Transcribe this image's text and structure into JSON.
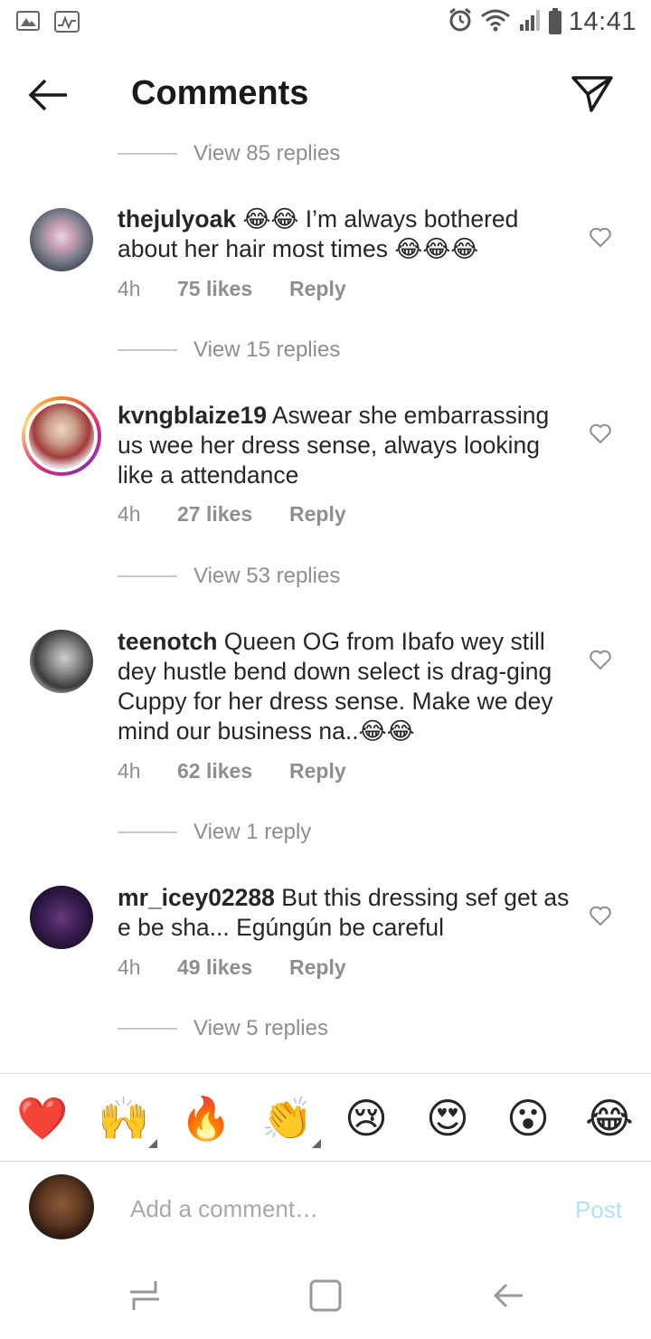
{
  "status_bar": {
    "time": "14:41",
    "left_icons": [
      "gallery-icon",
      "activity-icon"
    ],
    "right_icons": [
      "alarm-icon",
      "wifi-icon",
      "signal-icon",
      "battery-icon"
    ]
  },
  "header": {
    "title": "Comments",
    "back_icon": "arrow-left-icon",
    "share_icon": "paper-plane-icon"
  },
  "view_replies": [
    {
      "text": "View 85 replies"
    },
    {
      "text": "View 15 replies"
    },
    {
      "text": "View 53 replies"
    },
    {
      "text": "View 1 reply"
    },
    {
      "text": "View 5 replies"
    }
  ],
  "comments": [
    {
      "username": "thejulyoak",
      "text": " 😂😂 I’m always bothered about her hair most times 😂😂😂",
      "time": "4h",
      "likes": "75 likes",
      "reply": "Reply"
    },
    {
      "username": "kvngblaize19",
      "text": " Aswear she embarrassing us wee her dress sense, always looking like a attendance",
      "time": "4h",
      "likes": "27 likes",
      "reply": "Reply"
    },
    {
      "username": "teenotch",
      "text": " Queen OG  from Ibafo wey still dey hustle bend down select is drag-ging Cuppy for her dress sense. Make we dey mind our business na..😂😂",
      "time": "4h",
      "likes": "62 likes",
      "reply": "Reply"
    },
    {
      "username": "mr_icey02288",
      "text": " But this dressing sef get as e be sha... Egúngún be careful",
      "time": "4h",
      "likes": "49 likes",
      "reply": "Reply"
    }
  ],
  "emoji_bar": [
    "❤️",
    "🙌",
    "🔥",
    "👏",
    "😢",
    "😍",
    "😮",
    "😂"
  ],
  "input": {
    "placeholder": "Add a comment…",
    "post_label": "Post"
  },
  "colors": {
    "text": "#262626",
    "secondary": "#8e8e8e",
    "divider": "#dbdbdb",
    "post_disabled": "#b2dffc"
  }
}
